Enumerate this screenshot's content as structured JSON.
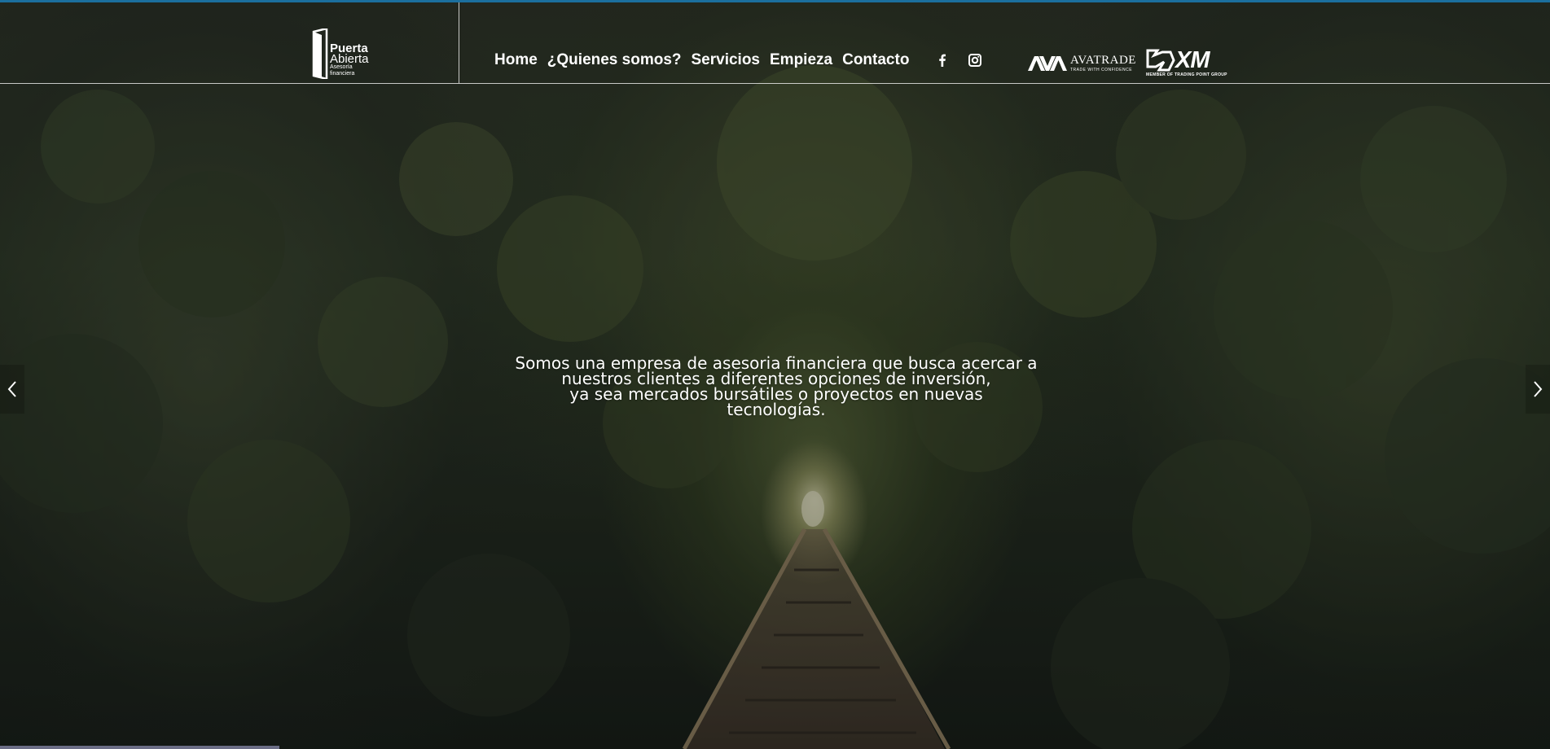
{
  "brand": {
    "logo_line1": "Puerta",
    "logo_line2": "Abierta",
    "logo_line3": "Asesoría",
    "logo_line4": "financiera"
  },
  "nav": {
    "items": [
      {
        "label": "Home"
      },
      {
        "label": "¿Quienes somos?"
      },
      {
        "label": "Servicios"
      },
      {
        "label": "Empieza"
      },
      {
        "label": "Contacto"
      }
    ]
  },
  "social": {
    "facebook_icon": "facebook-icon",
    "instagram_icon": "instagram-icon"
  },
  "partners": {
    "avatrade": {
      "name": "AVATRADE",
      "tagline": "TRADE WITH CONFIDENCE"
    },
    "xm": {
      "name": "XM",
      "tagline": "MEMBER OF TRADING POINT GROUP"
    }
  },
  "hero": {
    "line1": "Somos una empresa de asesoria financiera que busca acercar a",
    "line2": "nuestros clientes a diferentes opciones de inversión,",
    "line3": "ya sea mercados bursátiles o proyectos en nuevas",
    "line4": "tecnologías."
  },
  "slider": {
    "prev_icon": "chevron-left-icon",
    "next_icon": "chevron-right-icon",
    "progress": 0.18
  },
  "colors": {
    "accent": "#1b6f9e",
    "progress": "#6b6d86",
    "text": "#ffffff"
  }
}
